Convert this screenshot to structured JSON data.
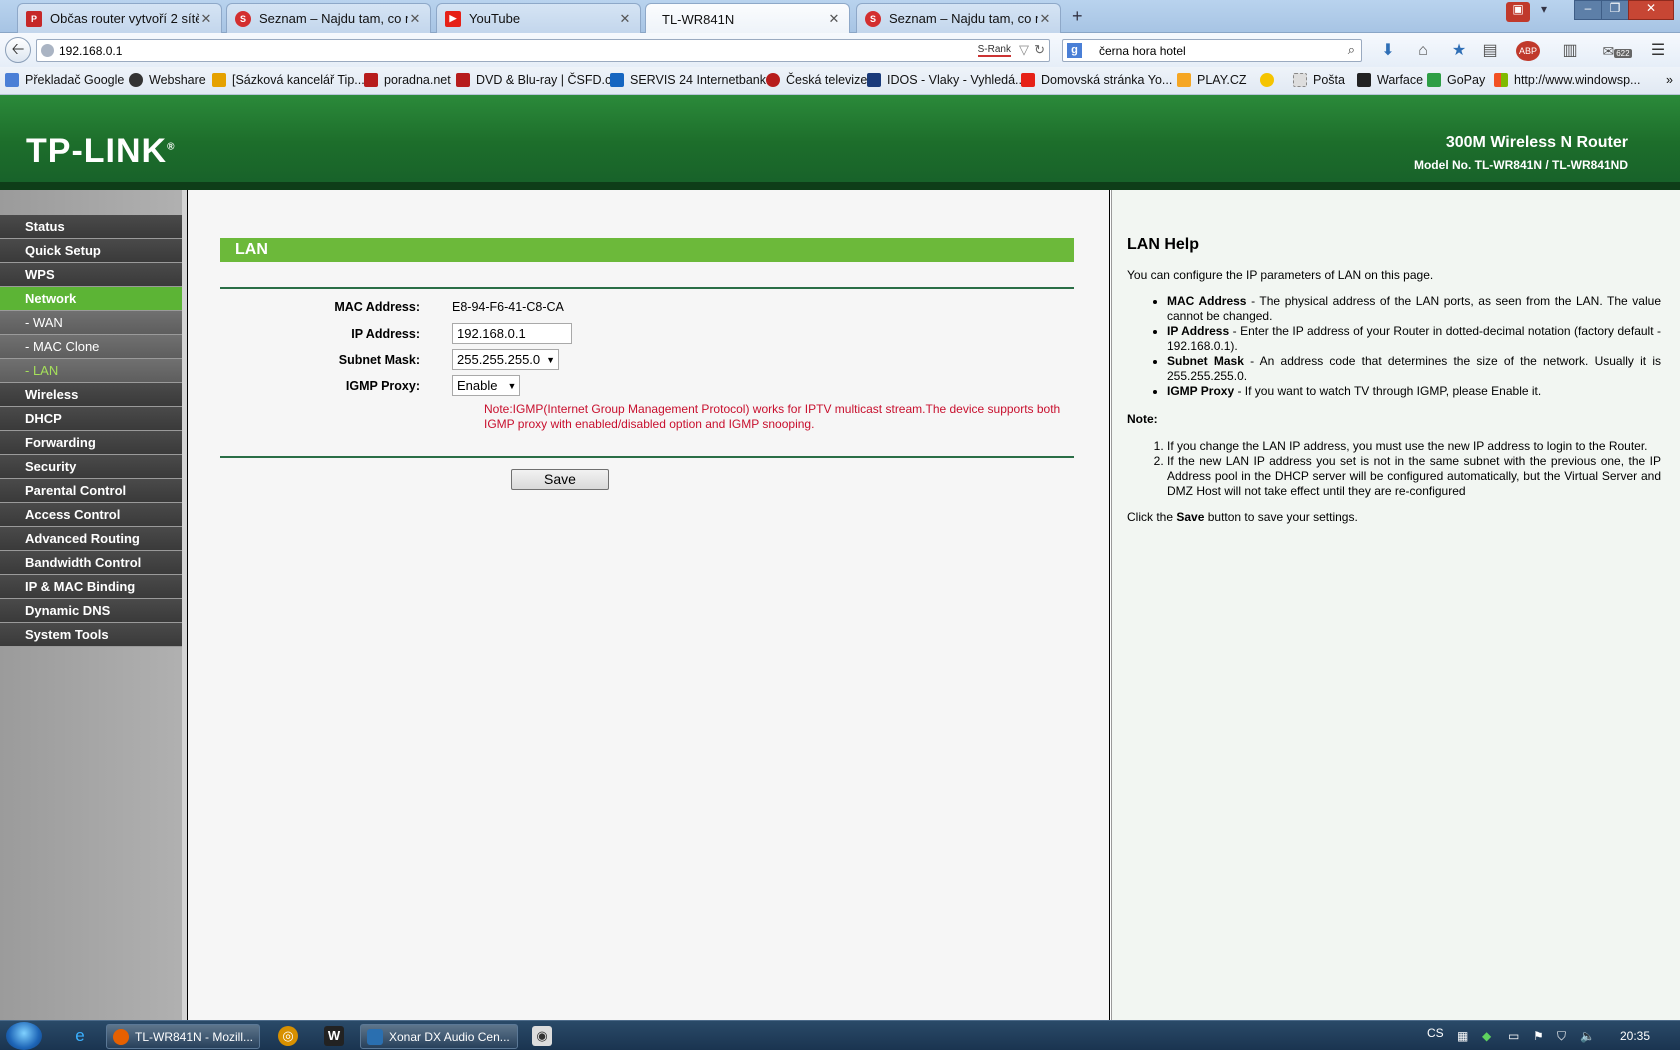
{
  "browser": {
    "tabs": [
      {
        "title": "Občas router vytvoří 2 sítě ...",
        "favicon": "pcnet-icon",
        "color": "#c62828"
      },
      {
        "title": "Seznam – Najdu tam, co n...",
        "favicon": "seznam-icon",
        "color": "#d32f2f"
      },
      {
        "title": "YouTube",
        "favicon": "youtube-icon",
        "color": "#e62117"
      },
      {
        "title": "TL-WR841N",
        "favicon": "",
        "color": ""
      },
      {
        "title": "Seznam – Najdu tam, co n...",
        "favicon": "seznam-icon",
        "color": "#d32f2f"
      }
    ],
    "url": "192.168.0.1",
    "srank_label": "S-Rank",
    "search_query": "černa hora  hotel",
    "bookmarks": [
      {
        "label": "Překladač Google",
        "color": "#4a7fd6"
      },
      {
        "label": "Webshare",
        "color": "#333333"
      },
      {
        "label": "[Sázková kancelář Tip...",
        "color": "#e5a100"
      },
      {
        "label": "poradna.net",
        "color": "#b71c1c"
      },
      {
        "label": "DVD & Blu-ray | ČSFD.cz",
        "color": "#b71c1c"
      },
      {
        "label": "SERVIS 24 Internetbank...",
        "color": "#1565c0"
      },
      {
        "label": "Česká televize",
        "color": "#b71c1c"
      },
      {
        "label": "IDOS - Vlaky - Vyhledá...",
        "color": "#1a3a7a"
      },
      {
        "label": "Domovská stránka Yo...",
        "color": "#e62117"
      },
      {
        "label": "PLAY.CZ",
        "color": "#f5a623"
      },
      {
        "label": "Pošta",
        "color": "#888888"
      },
      {
        "label": "Warface",
        "color": "#222222"
      },
      {
        "label": "GoPay",
        "color": "#2e9e45"
      },
      {
        "label": "http://www.windowsp...",
        "color": "#3b7bd4"
      }
    ],
    "toolbar_badge": "622"
  },
  "router": {
    "brand": "TP-LINK",
    "product_line": "300M Wireless N Router",
    "model": "Model No. TL-WR841N / TL-WR841ND",
    "menu": [
      {
        "label": "Status",
        "type": "main"
      },
      {
        "label": "Quick Setup",
        "type": "main"
      },
      {
        "label": "WPS",
        "type": "main"
      },
      {
        "label": "Network",
        "type": "active"
      },
      {
        "label": "- WAN",
        "type": "sub"
      },
      {
        "label": "- MAC Clone",
        "type": "sub"
      },
      {
        "label": "- LAN",
        "type": "current"
      },
      {
        "label": "Wireless",
        "type": "main"
      },
      {
        "label": "DHCP",
        "type": "main"
      },
      {
        "label": "Forwarding",
        "type": "main"
      },
      {
        "label": "Security",
        "type": "main"
      },
      {
        "label": "Parental Control",
        "type": "main"
      },
      {
        "label": "Access Control",
        "type": "main"
      },
      {
        "label": "Advanced Routing",
        "type": "main"
      },
      {
        "label": "Bandwidth Control",
        "type": "main"
      },
      {
        "label": "IP & MAC Binding",
        "type": "main"
      },
      {
        "label": "Dynamic DNS",
        "type": "main"
      },
      {
        "label": "System Tools",
        "type": "main"
      }
    ],
    "lan": {
      "title": "LAN",
      "mac_label": "MAC Address:",
      "mac_value": "E8-94-F6-41-C8-CA",
      "ip_label": "IP Address:",
      "ip_value": "192.168.0.1",
      "mask_label": "Subnet Mask:",
      "mask_value": "255.255.255.0",
      "igmp_label": "IGMP Proxy:",
      "igmp_value": "Enable",
      "note_line1": "Note:IGMP(Internet Group Management Protocol) works for IPTV multicast stream.The device supports both",
      "note_line2": "IGMP proxy with enabled/disabled option and IGMP snooping.",
      "save_label": "Save"
    },
    "help": {
      "title": "LAN Help",
      "intro": "You can configure the IP parameters of LAN on this page.",
      "items": [
        {
          "term": "MAC Address",
          "desc": " - The physical address of the LAN ports, as seen from the LAN. The value cannot be changed."
        },
        {
          "term": "IP Address",
          "desc": " - Enter the IP address of your Router in dotted-decimal notation (factory default - 192.168.0.1)."
        },
        {
          "term": "Subnet Mask",
          "desc": " - An address code that determines the size of the network. Usually it is 255.255.255.0."
        },
        {
          "term": "IGMP Proxy",
          "desc": " - If you want to watch TV through IGMP, please Enable it."
        }
      ],
      "note_label": "Note:",
      "notes": [
        "If you change the LAN IP address, you must use the new IP address to login to the Router.",
        "If the new LAN IP address you set is not in the same subnet with the previous one, the IP Address pool in the DHCP server will be configured automatically, but the Virtual Server and DMZ Host will not take effect until they are re-configured"
      ],
      "click_pre": "Click the ",
      "click_bold": "Save",
      "click_post": " button to save your settings."
    }
  },
  "taskbar": {
    "apps": [
      {
        "label": "TL-WR841N - Mozill...",
        "color": "#e66000"
      },
      {
        "label": "Xonar DX Audio Cen...",
        "color": "#2a6fb0"
      }
    ],
    "lang": "CS",
    "time": "20:35"
  }
}
